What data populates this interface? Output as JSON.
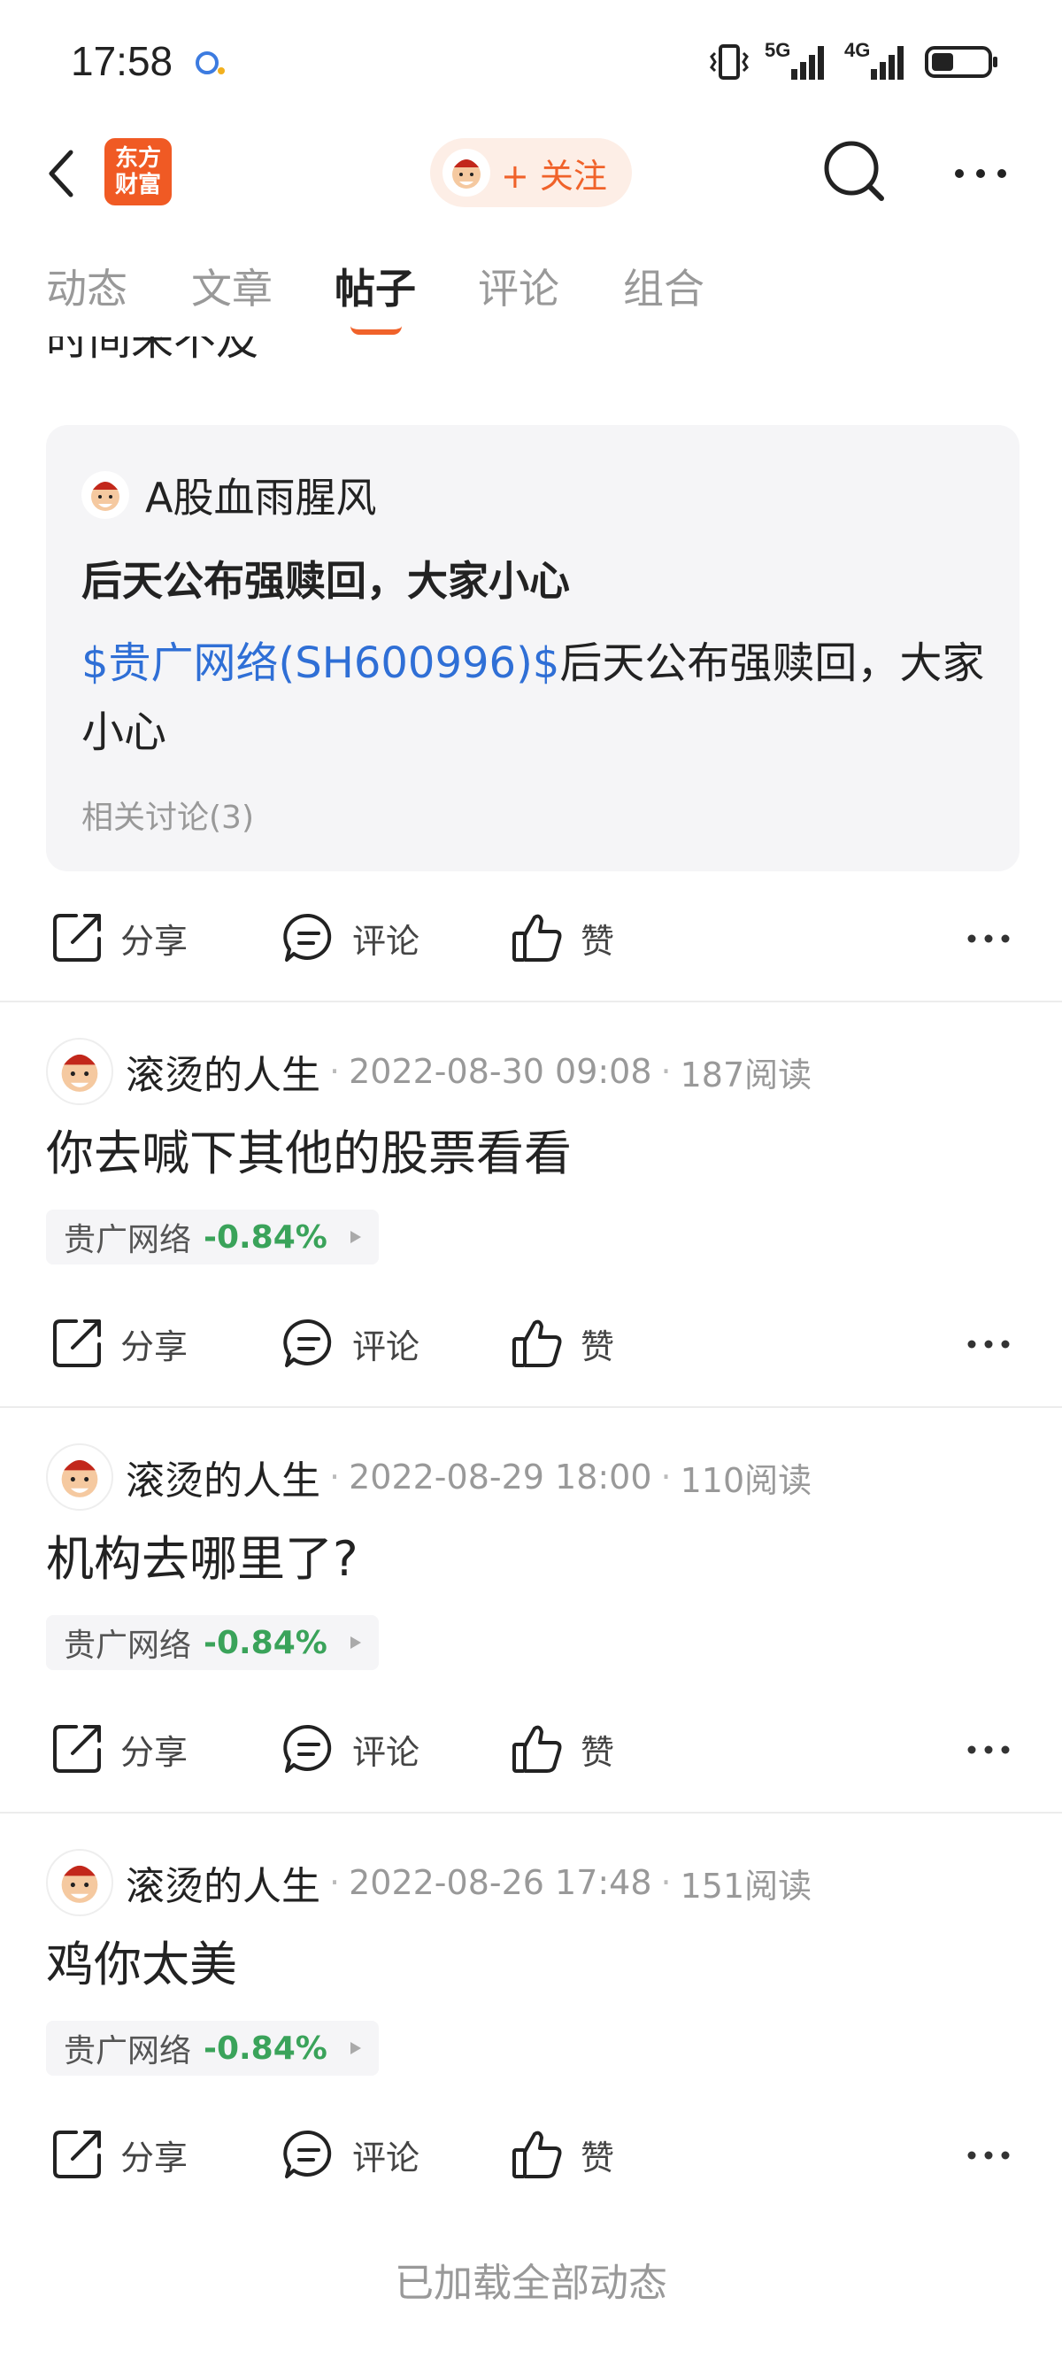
{
  "status_bar": {
    "time": "17:58",
    "network_1": "5G",
    "network_2": "4G"
  },
  "header": {
    "logo_line1": "东方",
    "logo_line2": "财富",
    "follow_label": "+ 关注"
  },
  "tabs": [
    {
      "label": "动态"
    },
    {
      "label": "文章"
    },
    {
      "label": "帖子",
      "active": true
    },
    {
      "label": "评论"
    },
    {
      "label": "组合"
    }
  ],
  "cutoff_text": "时间来不及",
  "quote_card": {
    "author": "A股血雨腥风",
    "title": "后天公布强赎回，大家小心",
    "stock_link": "$贵广网络(SH600996)$",
    "body": "后天公布强赎回，大家小心",
    "related": "相关讨论(3)"
  },
  "actions": {
    "share": "分享",
    "comment": "评论",
    "like": "赞"
  },
  "posts": [
    {
      "author": "滚烫的人生",
      "date": "2022-08-30 09:08",
      "reads": "187阅读",
      "text": "你去喊下其他的股票看看",
      "stock_name": "贵广网络",
      "stock_change": "-0.84%"
    },
    {
      "author": "滚烫的人生",
      "date": "2022-08-29 18:00",
      "reads": "110阅读",
      "text": "机构去哪里了?",
      "stock_name": "贵广网络",
      "stock_change": "-0.84%"
    },
    {
      "author": "滚烫的人生",
      "date": "2022-08-26 17:48",
      "reads": "151阅读",
      "text": "鸡你太美",
      "stock_name": "贵广网络",
      "stock_change": "-0.84%"
    }
  ],
  "footer": "已加载全部动态",
  "colors": {
    "accent": "#f0622a",
    "link": "#2f6fd6",
    "down": "#3aa35a"
  }
}
